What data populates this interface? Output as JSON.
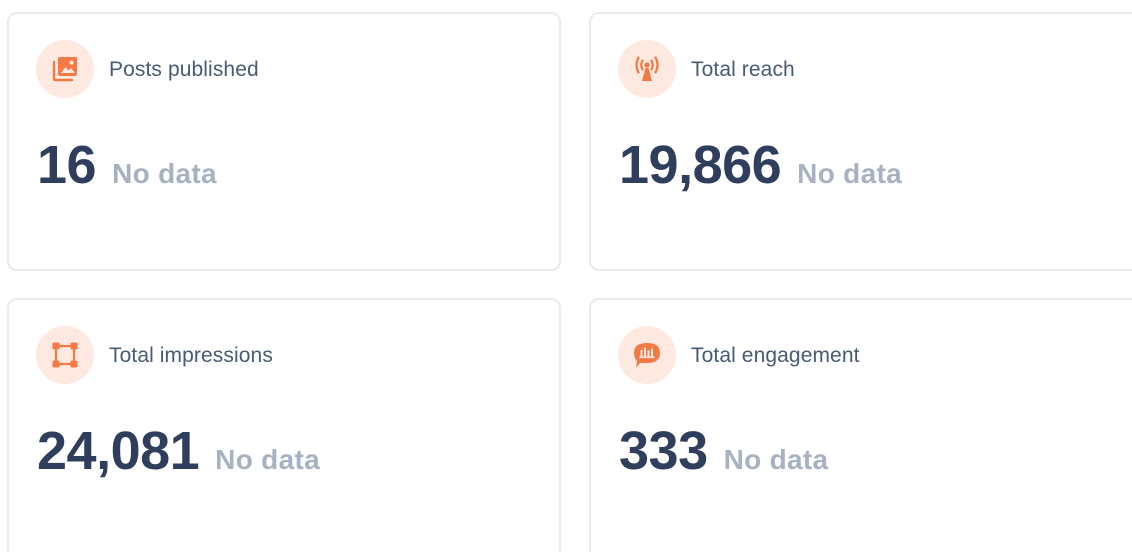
{
  "cards": [
    {
      "label": "Posts published",
      "value": "16",
      "comparison": "No data",
      "icon": "image-gallery-icon"
    },
    {
      "label": "Total reach",
      "value": "19,866",
      "comparison": "No data",
      "icon": "broadcast-tower-icon"
    },
    {
      "label": "Total impressions",
      "value": "24,081",
      "comparison": "No data",
      "icon": "frame-select-icon"
    },
    {
      "label": "Total engagement",
      "value": "333",
      "comparison": "No data",
      "icon": "chat-chart-icon"
    }
  ],
  "colors": {
    "accent": "#f47a45",
    "icon_bg": "#fde9df",
    "value": "#2f3e5c",
    "label": "#4a5a74",
    "muted": "#a8b1c1",
    "card_border": "#e7eaef"
  }
}
